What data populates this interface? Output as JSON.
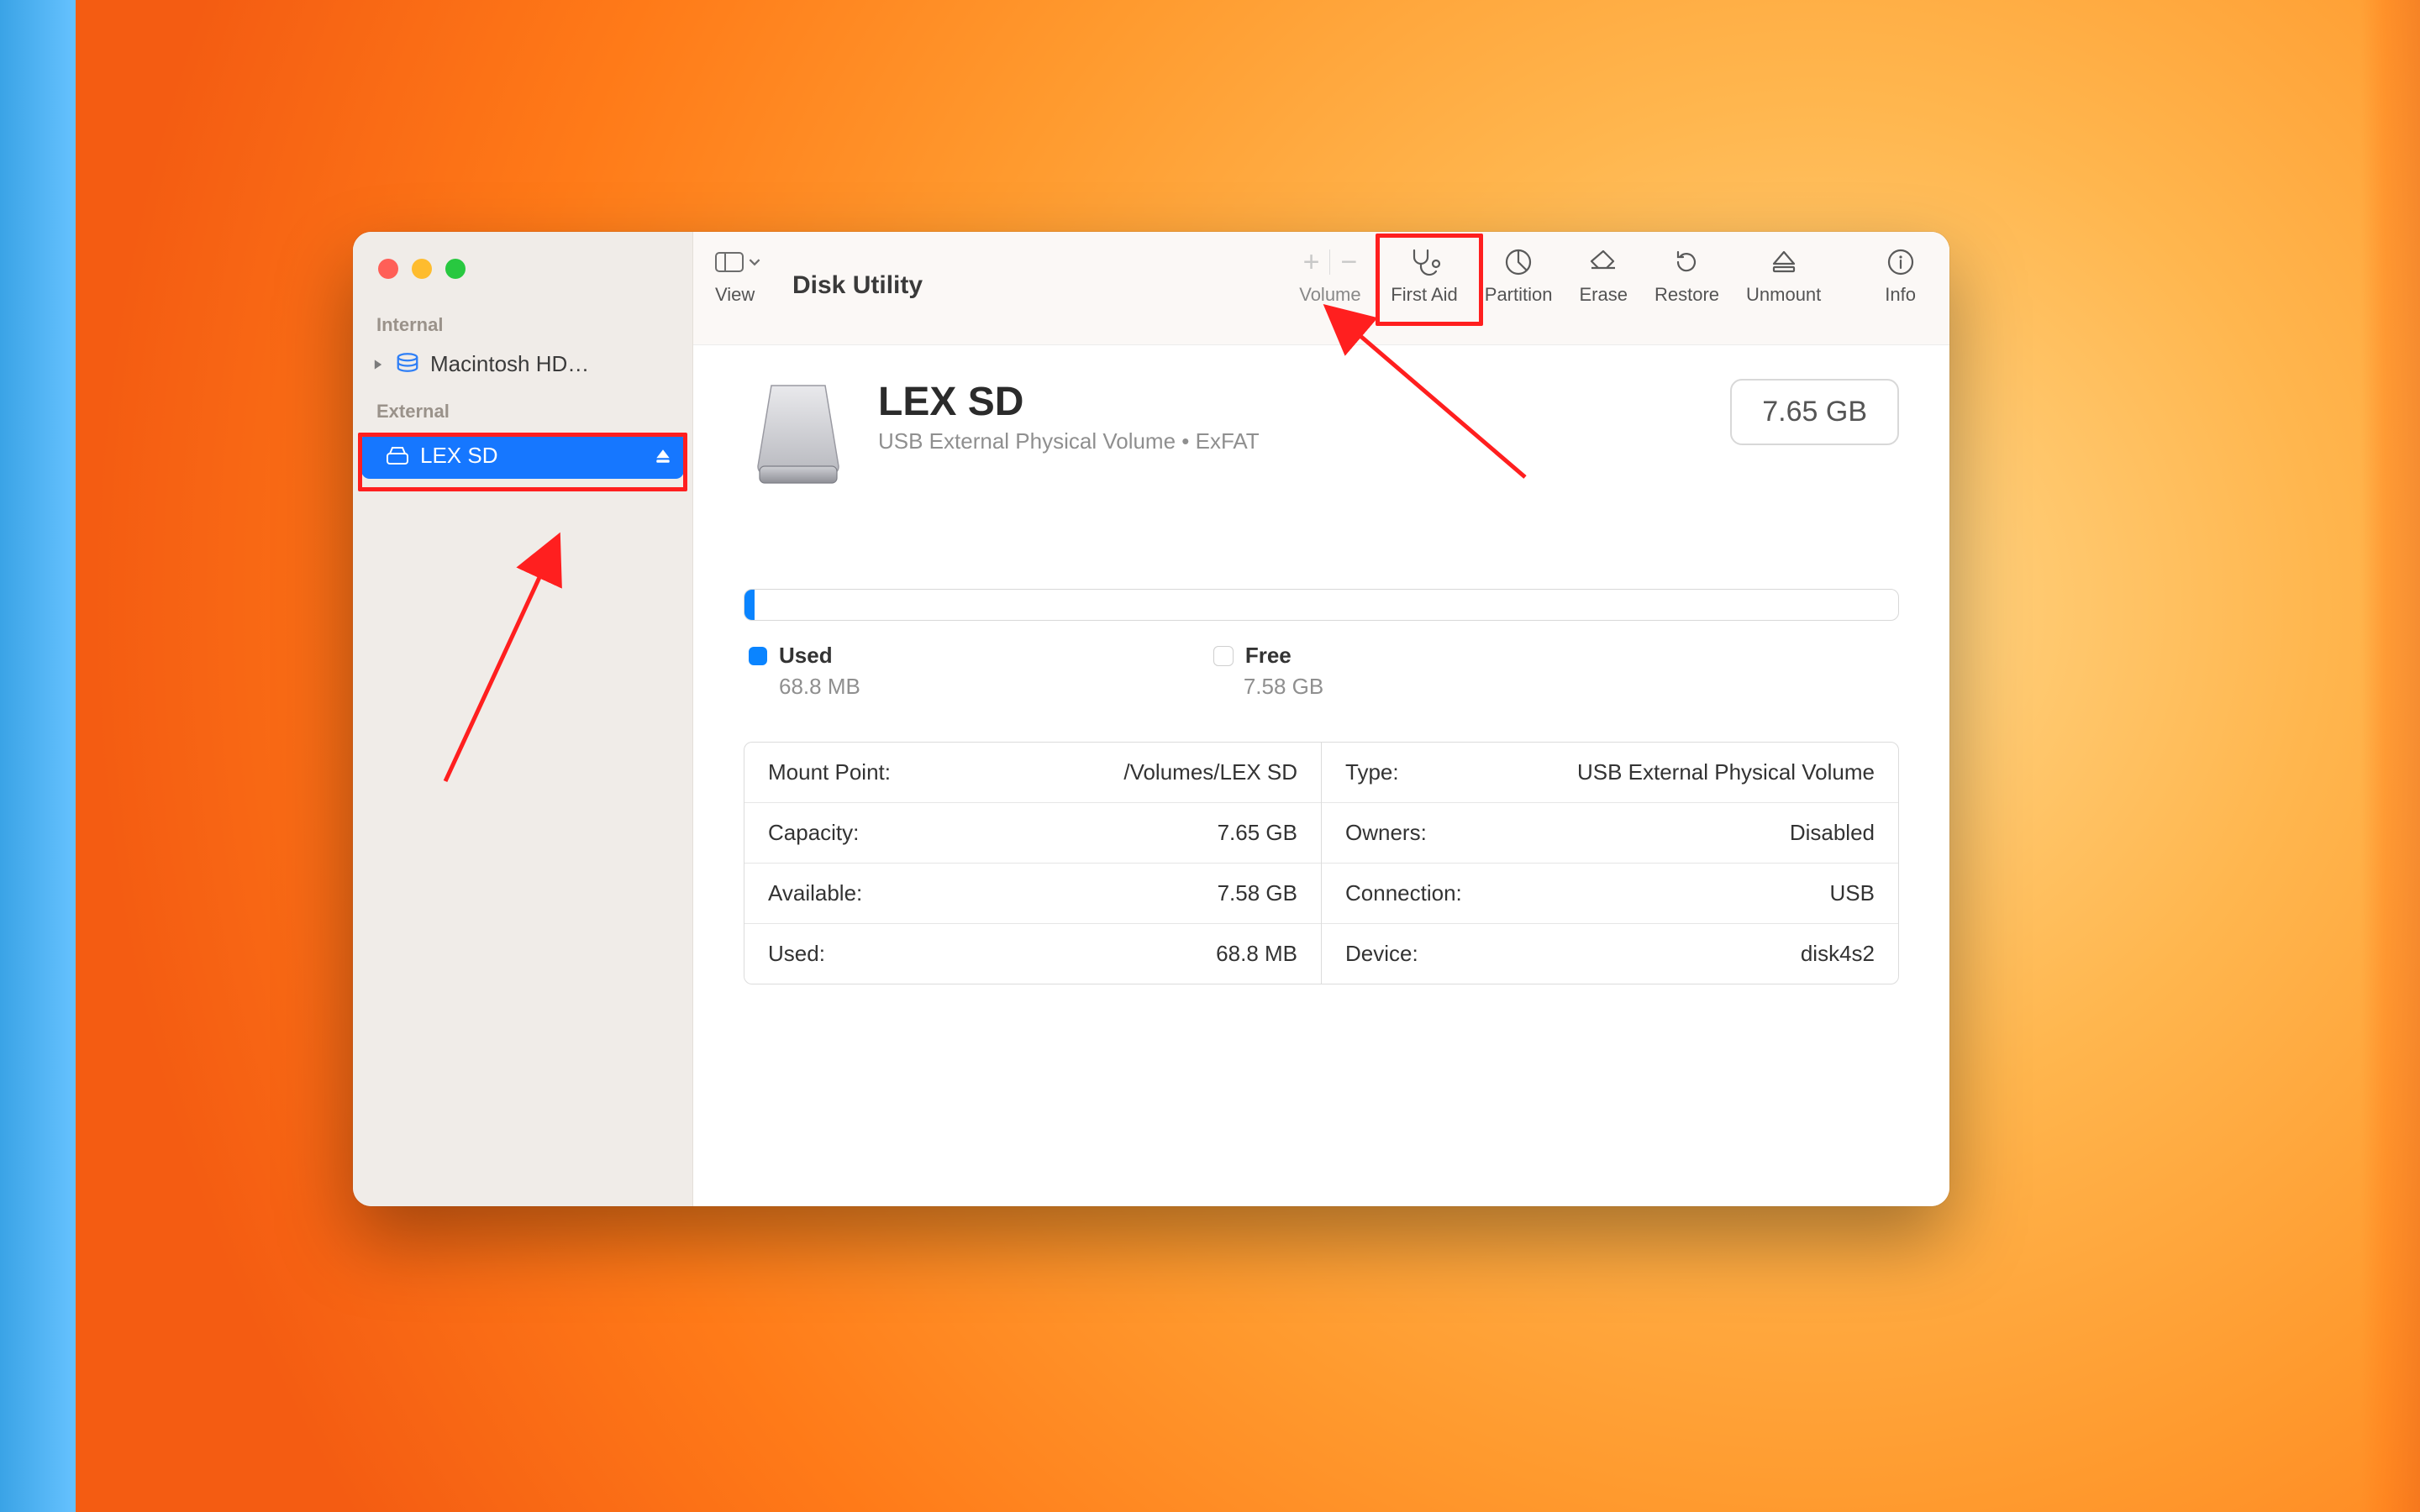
{
  "app_title": "Disk Utility",
  "toolbar": {
    "view_label": "View",
    "volume_label": "Volume",
    "first_aid_label": "First Aid",
    "partition_label": "Partition",
    "erase_label": "Erase",
    "restore_label": "Restore",
    "unmount_label": "Unmount",
    "info_label": "Info"
  },
  "sidebar": {
    "sections": {
      "internal_label": "Internal",
      "external_label": "External"
    },
    "internal_item": "Macintosh HD…",
    "external_item": "LEX SD"
  },
  "volume": {
    "name": "LEX SD",
    "subtitle": "USB External Physical Volume • ExFAT",
    "capacity_badge": "7.65 GB"
  },
  "usage": {
    "used_label": "Used",
    "used_value": "68.8 MB",
    "free_label": "Free",
    "free_value": "7.58 GB",
    "used_color": "#0a84ff",
    "free_color": "#ffffff"
  },
  "details": {
    "left": [
      {
        "k": "Mount Point:",
        "v": "/Volumes/LEX SD"
      },
      {
        "k": "Capacity:",
        "v": "7.65 GB"
      },
      {
        "k": "Available:",
        "v": "7.58 GB"
      },
      {
        "k": "Used:",
        "v": "68.8 MB"
      }
    ],
    "right": [
      {
        "k": "Type:",
        "v": "USB External Physical Volume"
      },
      {
        "k": "Owners:",
        "v": "Disabled"
      },
      {
        "k": "Connection:",
        "v": "USB"
      },
      {
        "k": "Device:",
        "v": "disk4s2"
      }
    ]
  }
}
